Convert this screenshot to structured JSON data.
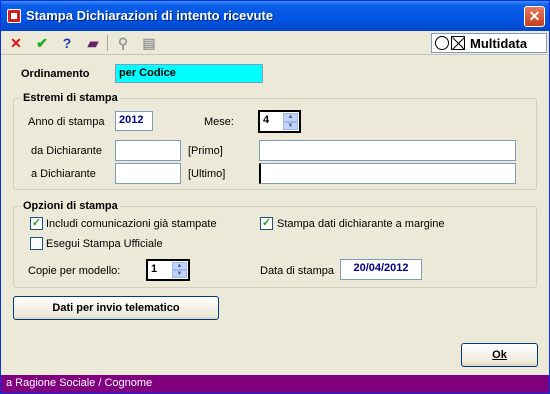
{
  "window": {
    "title": "Stampa Dichiarazioni di intento ricevute",
    "close_glyph": "✕"
  },
  "toolbar": {
    "icons": [
      "cancel-icon",
      "confirm-icon",
      "help-icon",
      "book-icon",
      "binoculars-icon",
      "print-preview-icon"
    ],
    "cancel_glyph": "✕",
    "confirm_glyph": "✔",
    "help_glyph": "?",
    "book_glyph": "▰",
    "binoculars_glyph": "⚲",
    "preview_glyph": "▤",
    "brand": "Multidata"
  },
  "ordinamento": {
    "label": "Ordinamento",
    "value": "per Codice"
  },
  "estremi": {
    "title": "Estremi di stampa",
    "anno_label": "Anno di stampa",
    "anno_value": "2012",
    "mese_label": "Mese:",
    "mese_value": "4",
    "da_label": "da Dichiarante",
    "da_value": "",
    "da_hint": "[Primo]",
    "da_name": "",
    "a_label": "a Dichiarante",
    "a_value": "",
    "a_hint": "[Ultimo]",
    "a_name": ""
  },
  "opzioni": {
    "title": "Opzioni di stampa",
    "includi_label": "Includi comunicazioni già stampate",
    "includi_checked": true,
    "stampa_dati_label": "Stampa dati dichiarante a margine",
    "stampa_dati_checked": true,
    "esegui_label": "Esegui Stampa Ufficiale",
    "esegui_checked": false,
    "copie_label": "Copie per modello:",
    "copie_value": "1",
    "data_label": "Data di stampa",
    "data_value": "20/04/2012"
  },
  "buttons": {
    "telematico": "Dati per invio telematico",
    "ok": "Ok"
  },
  "status": {
    "text": "a Ragione Sociale / Cognome"
  },
  "spinner": {
    "up": "▲",
    "down": "▼"
  },
  "check_glyph": "✓",
  "colors": {
    "title_bar": "#0054e3",
    "status_bar": "#800080",
    "highlight_field": "#00ffff"
  }
}
